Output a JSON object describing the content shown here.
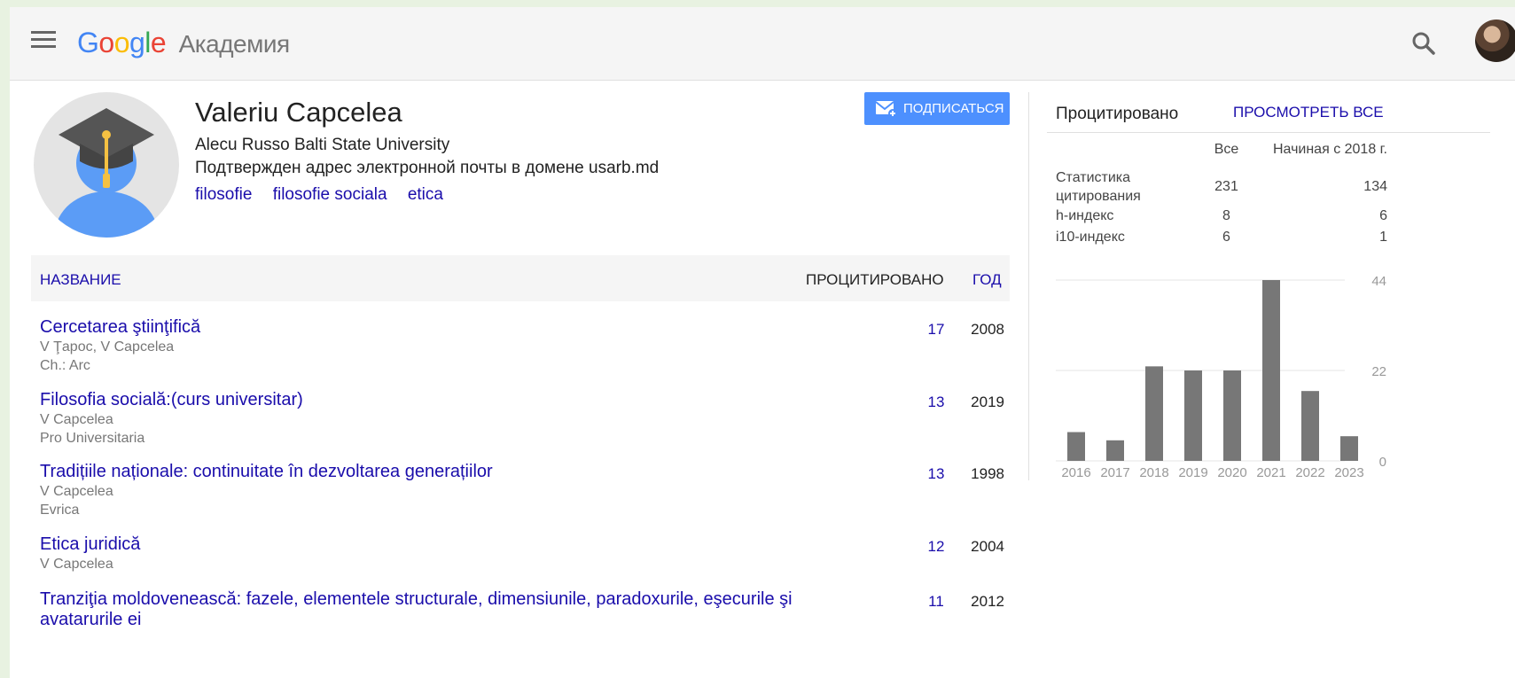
{
  "header": {
    "logo_google": "Google",
    "logo_product": "Академия"
  },
  "profile": {
    "name": "Valeriu Capcelea",
    "affiliation": "Alecu Russo Balti State University",
    "email_verified": "Подтвержден адрес электронной почты в домене usarb.md",
    "tags": [
      "filosofie",
      "filosofie sociala",
      "etica"
    ],
    "follow_label": "ПОДПИСАТЬСЯ"
  },
  "table": {
    "col_title": "НАЗВАНИЕ",
    "col_cited": "ПРОЦИТИРОВАНО",
    "col_year": "ГОД",
    "rows": [
      {
        "title": "Cercetarea ştiinţifică",
        "authors": "V Ţapoc, V Capcelea",
        "venue": "Ch.: Arc",
        "cited": "17",
        "year": "2008"
      },
      {
        "title": "Filosofia socială:(curs universitar)",
        "authors": "V Capcelea",
        "venue": "Pro Universitaria",
        "cited": "13",
        "year": "2019"
      },
      {
        "title": "Tradițiile naționale: continuitate în dezvoltarea generațiilor",
        "authors": "V Capcelea",
        "venue": "Evrica",
        "cited": "13",
        "year": "1998"
      },
      {
        "title": "Etica juridică",
        "authors": "V Capcelea",
        "venue": "",
        "cited": "12",
        "year": "2004"
      },
      {
        "title": "Tranziţia moldovenească: fazele, elementele structurale, dimensiunile, paradoxurile, eşecurile şi avatarurile ei",
        "authors": "",
        "venue": "",
        "cited": "11",
        "year": "2012"
      }
    ]
  },
  "sidebar": {
    "title": "Процитировано",
    "view_all": "ПРОСМОТРЕТЬ ВСЕ",
    "col_all": "Все",
    "col_since": "Начиная с 2018 г.",
    "stats": [
      {
        "label_1": "Статистика",
        "label_2": "цитирования",
        "all": "231",
        "since": "134"
      },
      {
        "label_1": "h-индекс",
        "label_2": "",
        "all": "8",
        "since": "6"
      },
      {
        "label_1": "i10-индекс",
        "label_2": "",
        "all": "6",
        "since": "1"
      }
    ]
  },
  "chart_data": {
    "type": "bar",
    "categories": [
      "2016",
      "2017",
      "2018",
      "2019",
      "2020",
      "2021",
      "2022",
      "2023"
    ],
    "values": [
      7,
      5,
      23,
      22,
      22,
      44,
      17,
      6
    ],
    "ylim": [
      0,
      44
    ],
    "yticks": [
      "44",
      "22",
      "0"
    ],
    "bar_color": "#777777",
    "grid": true
  }
}
